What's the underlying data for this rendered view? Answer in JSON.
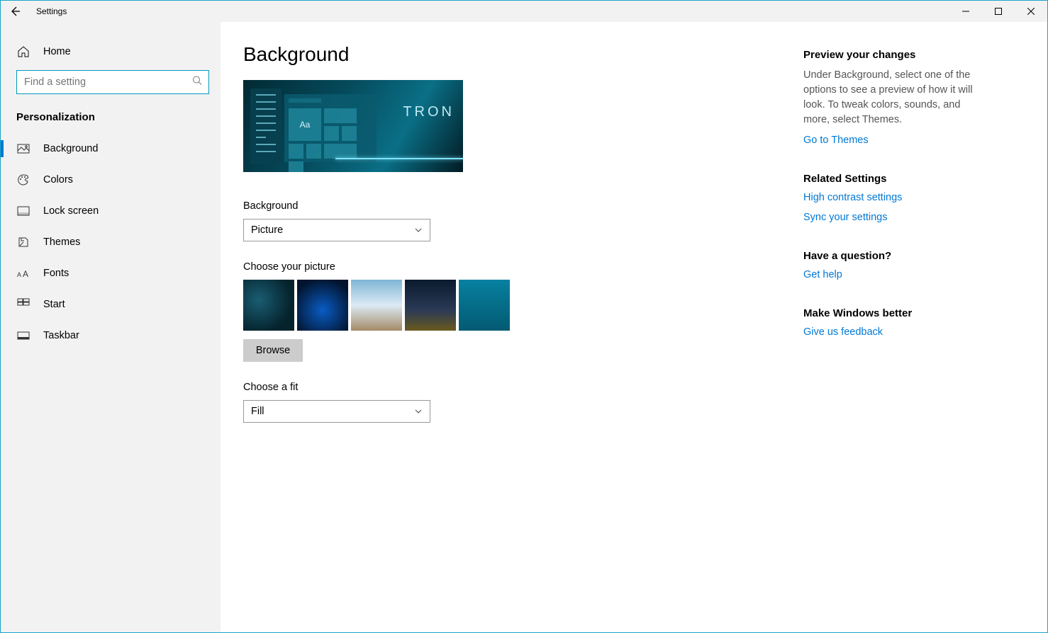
{
  "window": {
    "title": "Settings"
  },
  "sidebar": {
    "home": "Home",
    "search_placeholder": "Find a setting",
    "category": "Personalization",
    "items": [
      {
        "label": "Background"
      },
      {
        "label": "Colors"
      },
      {
        "label": "Lock screen"
      },
      {
        "label": "Themes"
      },
      {
        "label": "Fonts"
      },
      {
        "label": "Start"
      },
      {
        "label": "Taskbar"
      }
    ]
  },
  "main": {
    "title": "Background",
    "preview_sample_text": "Aa",
    "preview_brand": "TRON",
    "bg_label": "Background",
    "bg_value": "Picture",
    "choose_label": "Choose your picture",
    "browse": "Browse",
    "fit_label": "Choose a fit",
    "fit_value": "Fill"
  },
  "right": {
    "preview_h": "Preview your changes",
    "preview_p": "Under Background, select one of the options to see a preview of how it will look. To tweak colors, sounds, and more, select Themes.",
    "themes_link": "Go to Themes",
    "related_h": "Related Settings",
    "hc_link": "High contrast settings",
    "sync_link": "Sync your settings",
    "question_h": "Have a question?",
    "help_link": "Get help",
    "better_h": "Make Windows better",
    "feedback_link": "Give us feedback"
  }
}
